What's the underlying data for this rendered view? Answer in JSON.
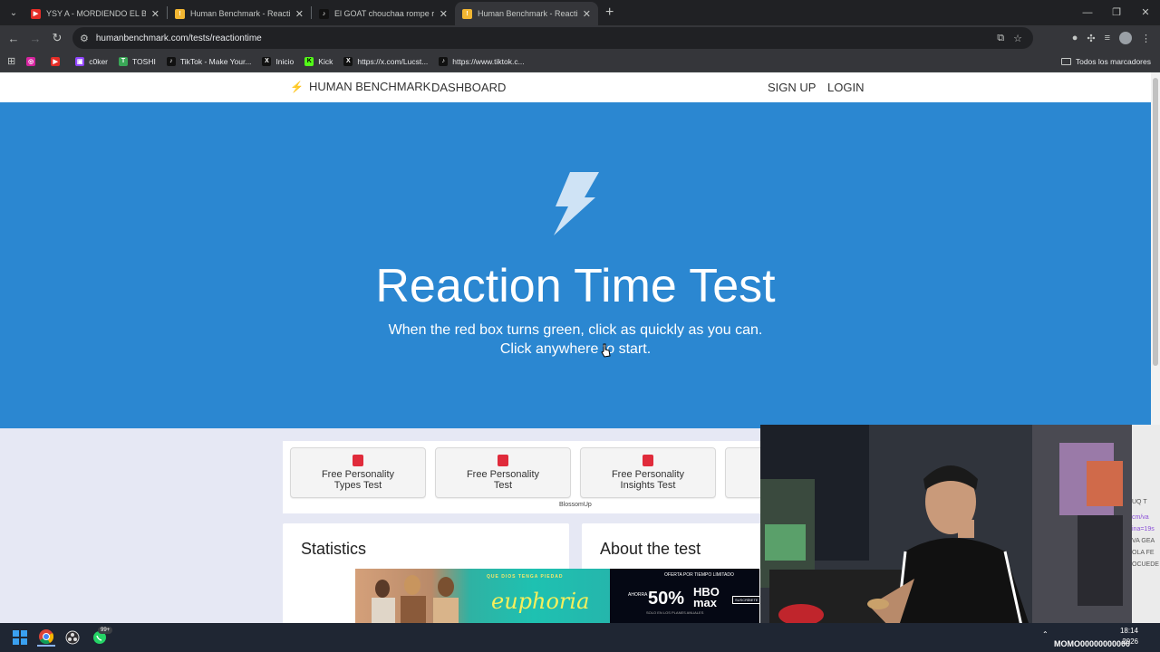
{
  "browser": {
    "tabs": [
      {
        "title": "YSY A - MORDIENDO EL BOZAL",
        "favicon_color": "#e52d27",
        "active": false
      },
      {
        "title": "Human Benchmark - Reaction T",
        "favicon_color": "#f2b632",
        "active": false
      },
      {
        "title": "El GOAT chouchaa rompe récor",
        "favicon_color": "#111111",
        "active": false
      },
      {
        "title": "Human Benchmark - Reaction T",
        "favicon_color": "#f2b632",
        "active": true
      }
    ],
    "url": "humanbenchmark.com/tests/reactiontime",
    "bookmarks": [
      {
        "label": "",
        "color": "#d6249f"
      },
      {
        "label": "",
        "color": "#e52d27"
      },
      {
        "label": "c0ker",
        "color": "#9146ff"
      },
      {
        "label": "TOSHI",
        "color": "#3aa757"
      },
      {
        "label": "TikTok - Make Your...",
        "color": "#111111"
      },
      {
        "label": "Inicio",
        "color": "#111111"
      },
      {
        "label": "Kick",
        "color": "#53fc18"
      },
      {
        "label": "https://x.com/Lucst...",
        "color": "#111111"
      },
      {
        "label": "https://www.tiktok.c...",
        "color": "#111111"
      }
    ],
    "all_bookmarks": "Todos los marcadores"
  },
  "site": {
    "brand": "HUMAN BENCHMARK",
    "nav": {
      "dashboard": "DASHBOARD",
      "signup": "SIGN UP",
      "login": "LOGIN"
    },
    "hero": {
      "title": "Reaction Time Test",
      "line1": "When the red box turns green, click as quickly as you can.",
      "line2": "Click anywhere to start.",
      "background": "#2b87d1"
    },
    "ads": [
      {
        "line1": "Free Personality",
        "line2": "Types Test"
      },
      {
        "line1": "Free Personality",
        "line2": "Test"
      },
      {
        "line1": "Free Personality",
        "line2": "Insights Test"
      }
    ],
    "ad_credit": "BlossomUp",
    "panels": {
      "statistics": "Statistics",
      "about": "About the test"
    },
    "banner": {
      "tags": "QUE  DIOS  TENGA  PIEDAD",
      "show": "euphoria",
      "offer": "OFERTA POR TIEMPO LIMITADO",
      "prefix": "AHORRA",
      "percent": "50%",
      "brand_top": "HBO",
      "brand_bottom": "max",
      "cta": "SUSCRÍBETE",
      "fine": "SOLO EN LOS PLANES ANUALES"
    }
  },
  "overlay": {
    "chat_lines": [
      "",
      "UQ T",
      "",
      "cm/va",
      "ina=19s",
      "VA GEA",
      "OLA FE",
      "OCUEDE"
    ],
    "streamer_name": "MOMO00000000000"
  },
  "taskbar": {
    "badge": "99+",
    "time": "18:14",
    "date": "2026"
  }
}
